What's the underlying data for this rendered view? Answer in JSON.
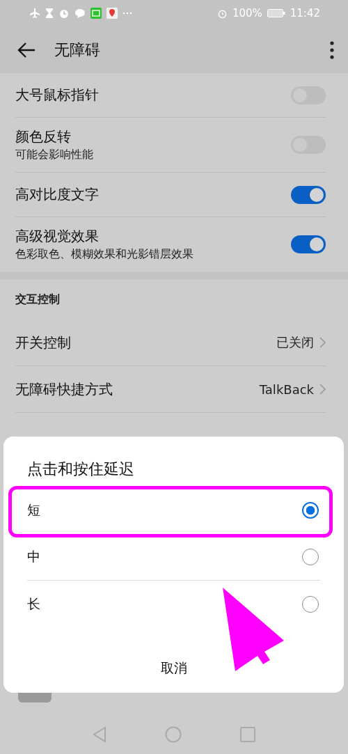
{
  "status_bar": {
    "battery": "100%",
    "time": "11:42"
  },
  "app_bar": {
    "title": "无障碍"
  },
  "settings": [
    {
      "kind": "toggle",
      "label": "大号鼠标指针",
      "on": false
    },
    {
      "kind": "toggle",
      "label": "颜色反转",
      "subtitle": "可能会影响性能",
      "on": false
    },
    {
      "kind": "toggle",
      "label": "高对比度文字",
      "on": true
    },
    {
      "kind": "toggle",
      "label": "高级视觉效果",
      "subtitle": "色彩取色、模糊效果和光影错层效果",
      "on": true
    }
  ],
  "section": {
    "header": "交互控制",
    "items": [
      {
        "kind": "link",
        "label": "开关控制",
        "value": "已关闭"
      },
      {
        "kind": "link",
        "label": "无障碍快捷方式",
        "value": "TalkBack"
      }
    ]
  },
  "dialog": {
    "title": "点击和按住延迟",
    "options": [
      {
        "label": "短",
        "selected": true
      },
      {
        "label": "中",
        "selected": false
      },
      {
        "label": "长",
        "selected": false
      }
    ],
    "cancel": "取消"
  }
}
